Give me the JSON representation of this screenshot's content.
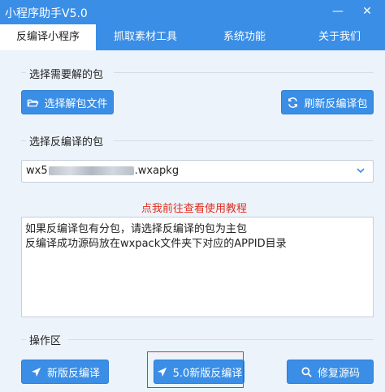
{
  "window": {
    "title": "小程序助手V5.0",
    "minimize_glyph": "—",
    "close_glyph": "✕"
  },
  "tabs": [
    {
      "label": "反编译小程序",
      "active": true
    },
    {
      "label": "抓取素材工具",
      "active": false
    },
    {
      "label": "系统功能",
      "active": false
    },
    {
      "label": "关于我们",
      "active": false
    }
  ],
  "section1": {
    "label": "选择需要解的包",
    "select_file_button": "选择解包文件",
    "refresh_button": "刷新反编译包"
  },
  "section2": {
    "label": "选择反编译的包",
    "selected_prefix": "wx5",
    "selected_suffix": ".wxapkg"
  },
  "tutorial_link": "点我前往查看使用教程",
  "info_lines": [
    "如果反编译包有分包，请选择反编译的包为主包",
    "反编译成功源码放在wxpack文件夹下对应的APPID目录"
  ],
  "operations": {
    "label": "操作区",
    "new_decompile_button": "新版反编译",
    "v5_decompile_button": "5.0新版反编译",
    "repair_button": "修复源码"
  },
  "colors": {
    "accent": "#3a8ee6",
    "background": "#ecf3fb",
    "link": "#e0301e",
    "highlight": "#d9342b"
  }
}
